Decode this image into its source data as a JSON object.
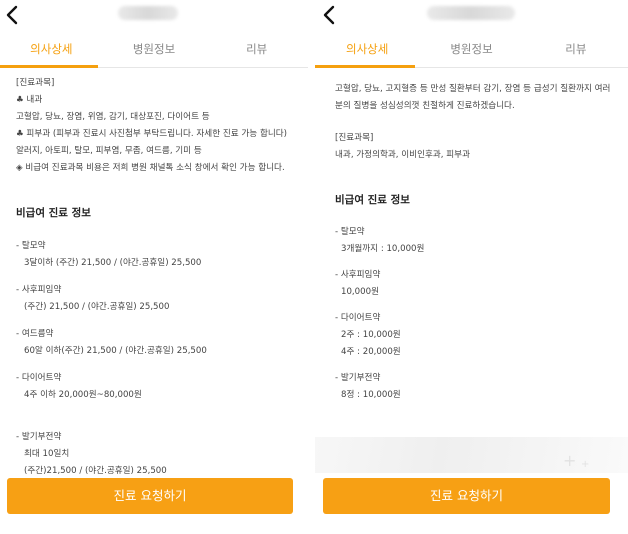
{
  "tabs": [
    "의사상세",
    "병원정보",
    "리뷰"
  ],
  "left": {
    "lines": [
      "[진료과목]",
      "♣ 내과",
      "고혈압, 당뇨, 장염, 위염, 감기, 대상포진, 다이어트 등",
      "♣ 피부과 (피부과 진료시 사진첨부 부탁드립니다. 자세한 진료 가능 합니다)",
      "알러지, 아토피, 탈모, 피부염, 무좀, 여드름, 기미 등",
      "◈ 비급여 진료과목 비용은 저희 병원 채널톡 소식 창에서 확인 가능 합니다."
    ],
    "section_title": "비급여 진료 정보",
    "items": [
      {
        "name": "- 탈모약",
        "details": [
          "3달이하 (주간) 21,500 / (야간.공휴일) 25,500"
        ]
      },
      {
        "name": "- 사후피임약",
        "details": [
          "(주간) 21,500  / (야간.공휴일) 25,500"
        ]
      },
      {
        "name": "- 여드름약",
        "details": [
          "60알 이하(주간) 21,500  / (야간.공휴일) 25,500"
        ]
      },
      {
        "name": "- 다이어트약",
        "details": [
          "4주 이하 20,000원~80,000원"
        ]
      },
      {
        "name": "- 발기부전약",
        "details": [
          "최대 10일치",
          "(주간)21,500 / (야간.공휴일) 25,500"
        ]
      }
    ],
    "button": "진료 요청하기"
  },
  "right": {
    "intro": [
      "고혈압, 당뇨, 고지혈증 등 만성 질환부터 감기, 장염 등 급성기 질환까지 여러",
      "분의 질병을 성심성의껏 친절하게 진료하겠습니다."
    ],
    "dept_title": "[진료과목]",
    "dept_list": "내과, 가정의학과, 이비인후과, 피부과",
    "section_title": "비급여 진료 정보",
    "items": [
      {
        "name": "- 탈모약",
        "details": [
          "3개월까지 : 10,000원"
        ]
      },
      {
        "name": "- 사후피임약",
        "details": [
          "10,000원"
        ]
      },
      {
        "name": "- 다이어트약",
        "details": [
          "2주 : 10,000원",
          "4주 : 20,000원"
        ]
      },
      {
        "name": "- 발기부전약",
        "details": [
          "8정 : 10,000원"
        ]
      }
    ],
    "button": "진료 요청하기"
  },
  "colors": {
    "accent": "#f5a00f",
    "button": "#f7a014"
  },
  "icons": {
    "back": "chevron-left-icon"
  }
}
